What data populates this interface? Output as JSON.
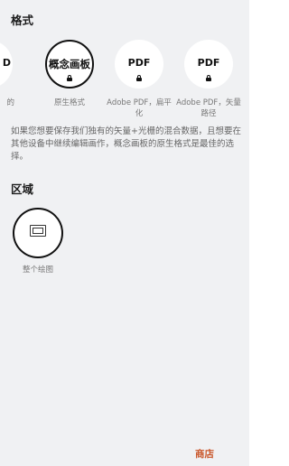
{
  "format_section": {
    "title": "格式"
  },
  "formats": [
    {
      "icon_text": "D",
      "label": "的"
    },
    {
      "icon_text": "概念画板",
      "label": "原生格式"
    },
    {
      "icon_text": "PDF",
      "label": "Adobe PDF，扁平化"
    },
    {
      "icon_text": "PDF",
      "label": "Adobe PDF，矢量路径"
    }
  ],
  "description": "如果您想要保存我们独有的矢量+光栅的混合数据，且想要在其他设备中继续编辑画作，概念画板的原生格式是最佳的选择。",
  "region_section": {
    "title": "区域"
  },
  "region": {
    "label": "整个绘图"
  },
  "footer": {
    "store_label": "商店"
  },
  "colors": {
    "accent": "#c9562a",
    "panel_bg": "#f0f1f3"
  }
}
